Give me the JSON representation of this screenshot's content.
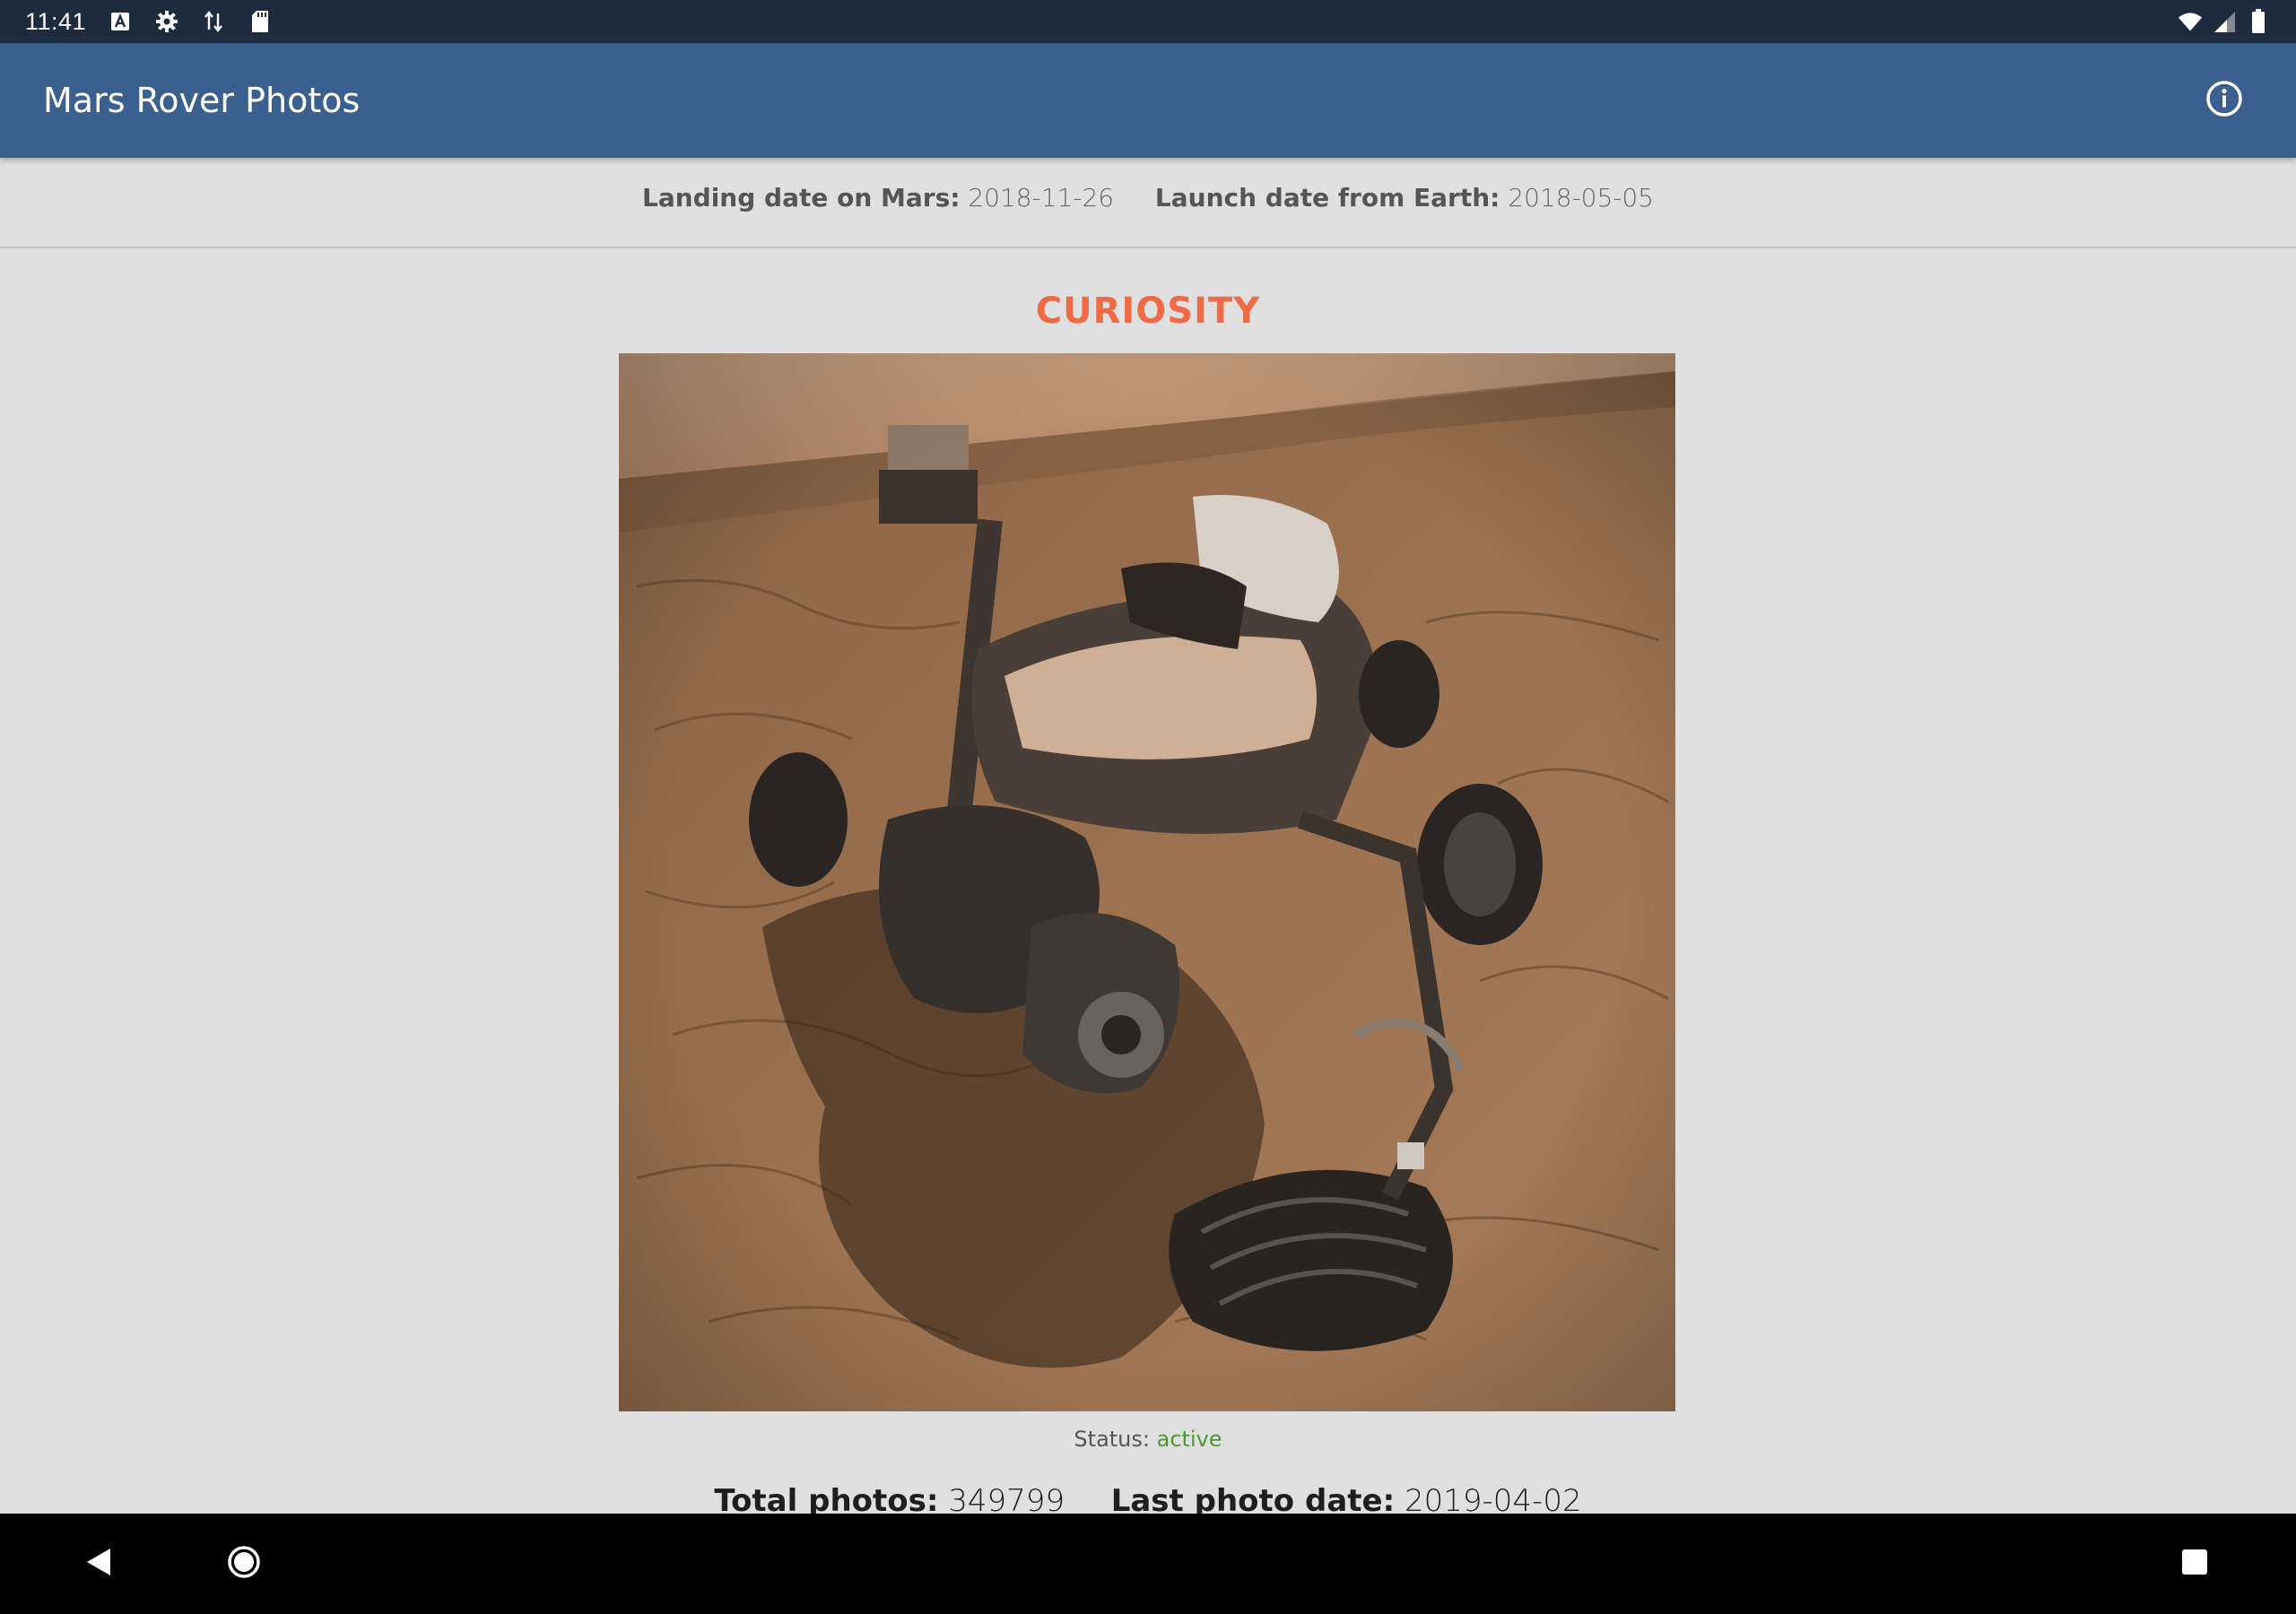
{
  "status_bar": {
    "time": "11:41",
    "icons": [
      "a-icon",
      "gear-icon",
      "data-transfer-icon",
      "sd-card-icon"
    ],
    "right_icons": [
      "wifi-icon",
      "signal-icon",
      "battery-icon"
    ]
  },
  "app_bar": {
    "title": "Mars Rover Photos",
    "info_icon": "info-icon"
  },
  "previous_rover": {
    "landing_label": "Landing date on Mars:",
    "landing_value": "2018-11-26",
    "launch_label": "Launch date from Earth:",
    "launch_value": "2018-05-05"
  },
  "rover": {
    "name": "CURIOSITY",
    "status_label": "Status:",
    "status_value": "active",
    "total_photos_label": "Total photos:",
    "total_photos_value": "349799",
    "last_photo_label": "Last photo date:",
    "last_photo_value": "2019-04-02"
  },
  "colors": {
    "status_bar": "#1e2a3d",
    "app_bar": "#3b5f8e",
    "background": "#e0e0e0",
    "rover_name": "#f06a45",
    "status_active": "#4a9a2e"
  },
  "nav_bar": {
    "back_icon": "back-icon",
    "home_icon": "home-icon",
    "recents_icon": "recents-icon"
  }
}
